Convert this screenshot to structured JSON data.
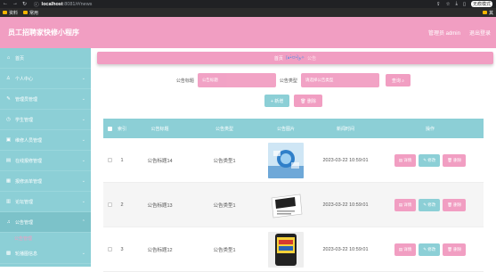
{
  "browser": {
    "url_host": "localhost",
    "url_rest": ":8081/#/news",
    "bookmarks": [
      "资料",
      "常用"
    ],
    "profile": "无痕模式",
    "right_bookmark": "其"
  },
  "header": {
    "title": "员工招聘家快修小程序",
    "user_label": "管理员 admin",
    "logout": "退出登录"
  },
  "sidebar": {
    "items": [
      {
        "icon": "home-icon",
        "glyph": "⌂",
        "label": "首页"
      },
      {
        "icon": "person-icon",
        "glyph": "♙",
        "label": "个人中心"
      },
      {
        "icon": "wrench-icon",
        "glyph": "✎",
        "label": "管理员管理"
      },
      {
        "icon": "clock-icon",
        "glyph": "◷",
        "label": "学生管理"
      },
      {
        "icon": "user-group-icon",
        "glyph": "▣",
        "label": "维修人员管理"
      },
      {
        "icon": "box-icon",
        "glyph": "▤",
        "label": "在线报修管理"
      },
      {
        "icon": "doc-icon",
        "glyph": "▦",
        "label": "报修派单管理"
      },
      {
        "icon": "list-icon",
        "glyph": "▥",
        "label": "论坛管理"
      },
      {
        "icon": "bell-icon",
        "glyph": "♫",
        "label": "公告管理"
      }
    ],
    "sub_item": "公告管理",
    "last_item": {
      "icon": "video-icon",
      "glyph": "▩",
      "label": "轮播图信息"
    }
  },
  "breadcrumb": {
    "home": "首页",
    "emoji": "(๑•̀ㅂ•́)و✧",
    "current": "公告"
  },
  "search": {
    "title_label": "公告标题",
    "title_placeholder": "公告标题",
    "type_label": "公告类型",
    "type_placeholder": "请选择公告类型",
    "button": "查询 ⌕"
  },
  "actions": {
    "add": "+ 新增",
    "delete": "🗑 删除"
  },
  "table": {
    "headers": [
      "索引",
      "公告标题",
      "公告类型",
      "公告图片",
      "新闻时间",
      "操作"
    ],
    "rows": [
      {
        "index": "1",
        "title": "公告标题14",
        "type": "公告类型1",
        "image": "news-image-tech",
        "time": "2023-03-22 10:59:01"
      },
      {
        "index": "2",
        "title": "公告标题13",
        "type": "公告类型1",
        "image": "news-image-paper",
        "time": "2023-03-22 10:59:01"
      },
      {
        "index": "3",
        "title": "公告标题12",
        "type": "公告类型1",
        "image": "news-image-hot",
        "time": "2023-03-22 10:59:01"
      }
    ],
    "row_buttons": {
      "detail": "▤ 详情",
      "edit": "✎ 修改",
      "delete": "🗑 删除"
    }
  },
  "colors": {
    "accent_pink": "#f19ec2",
    "accent_teal": "#8ccfd6"
  }
}
